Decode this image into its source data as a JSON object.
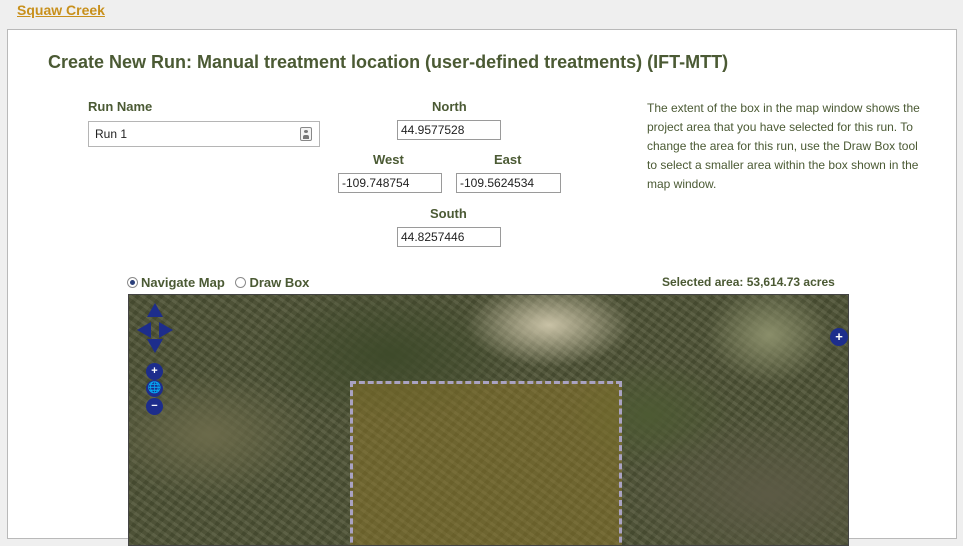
{
  "breadcrumb": {
    "label": "Squaw Creek"
  },
  "page": {
    "title": "Create New Run: Manual treatment location (user-defined treatments) (IFT-MTT)"
  },
  "form": {
    "run_name_label": "Run Name",
    "run_name_value": "Run 1",
    "north_label": "North",
    "north_value": "44.9577528",
    "west_label": "West",
    "west_value": "-109.748754",
    "east_label": "East",
    "east_value": "-109.5624534",
    "south_label": "South",
    "south_value": "44.8257446"
  },
  "help_text": "The extent of the box in the map window shows the project area that you have selected for this run. To change the area for this run, use the Draw Box tool to select a smaller area within the box shown in the map window.",
  "map_mode": {
    "options": [
      "Navigate Map",
      "Draw Box"
    ],
    "selected": "Navigate Map"
  },
  "selected_area": "Selected area: 53,614.73 acres",
  "map_controls": {
    "zoom_in": "+",
    "zoom_out": "−",
    "world": "🌐",
    "layer_switcher": "+"
  },
  "colors": {
    "brand_link": "#c8901c",
    "label_text": "#4b5a34",
    "nav_control": "#1d2d8c",
    "selection_fill": "#967d28",
    "selection_border": "#a9a2c2"
  }
}
